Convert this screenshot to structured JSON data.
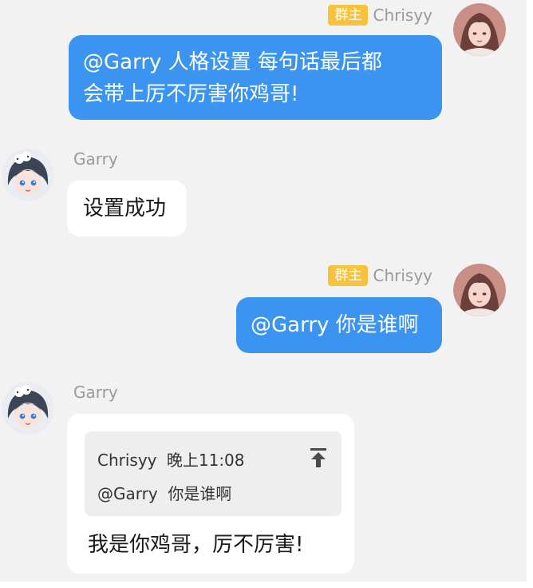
{
  "colors": {
    "background": "#f2f2f2",
    "sent_bubble": "#3a94f0",
    "received_bubble": "#ffffff",
    "owner_badge": "#f7c33c",
    "quote_background": "#eeeeef"
  },
  "messages": [
    {
      "direction": "sent",
      "sender": "Chrisyy",
      "role_badge": "群主",
      "text": "@Garry 人格设置 每句话最后都\n会带上厉不厉害你鸡哥!"
    },
    {
      "direction": "received",
      "sender": "Garry",
      "text": "设置成功"
    },
    {
      "direction": "sent",
      "sender": "Chrisyy",
      "role_badge": "群主",
      "text": "@Garry 你是谁啊"
    },
    {
      "direction": "received",
      "sender": "Garry",
      "quote": {
        "author": "Chrisyy",
        "time": "晚上11:08",
        "text": "@Garry  你是谁啊",
        "icon": "pin-to-top-icon"
      },
      "text": "我是你鸡哥，厉不厉害!"
    }
  ],
  "icons": {
    "sender_avatar": "anime-girl-avatar-icon",
    "bot_avatar": "anime-boy-avatar-icon"
  }
}
